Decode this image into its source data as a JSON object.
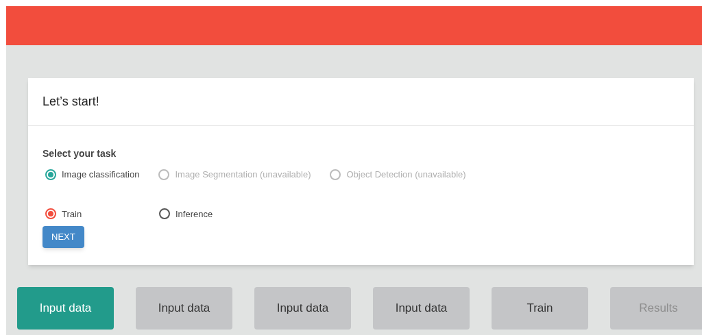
{
  "card": {
    "title": "Let’s start!",
    "task_label": "Select your task",
    "tasks": [
      {
        "label": "Image classification",
        "selected": true,
        "disabled": false
      },
      {
        "label": "Image Segmentation (unavailable)",
        "selected": false,
        "disabled": true
      },
      {
        "label": "Object Detection (unavailable)",
        "selected": false,
        "disabled": true
      }
    ],
    "modes": [
      {
        "label": "Train",
        "selected": true
      },
      {
        "label": "Inference",
        "selected": false
      }
    ],
    "next_button": "NEXT"
  },
  "steps": [
    {
      "label": "Input data",
      "selected": true,
      "disabled": false
    },
    {
      "label": "Input data",
      "selected": false,
      "disabled": false
    },
    {
      "label": "Input data",
      "selected": false,
      "disabled": false
    },
    {
      "label": "Input data",
      "selected": false,
      "disabled": false
    },
    {
      "label": "Train",
      "selected": false,
      "disabled": false
    },
    {
      "label": "Results",
      "selected": false,
      "disabled": true
    }
  ]
}
